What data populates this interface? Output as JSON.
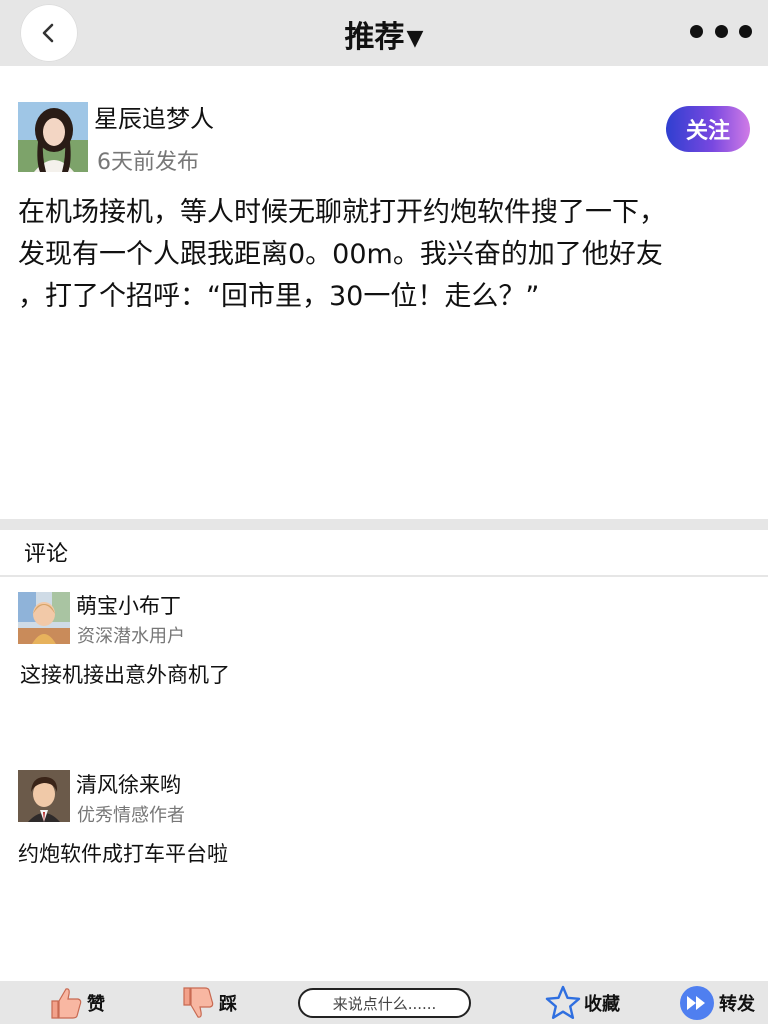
{
  "header": {
    "title": "推荐",
    "title_caret": "▼"
  },
  "post": {
    "author_name": "星辰追梦人",
    "time": "6天前发布",
    "follow_label": "关注",
    "lines": [
      "在机场接机，等人时候无聊就打开约炮软件搜了一下，",
      "发现有一个人跟我距离0。00m。我兴奋的加了他好友",
      "，打了个招呼：“回市里，30一位！走么？”"
    ]
  },
  "comments": {
    "title": "评论",
    "items": [
      {
        "name": "萌宝小布丁",
        "role": "资深潜水用户",
        "text": "这接机接出意外商机了"
      },
      {
        "name": "清风徐来哟",
        "role": "优秀情感作者",
        "text": "约炮软件成打车平台啦"
      }
    ]
  },
  "bottom_bar": {
    "like_label": "赞",
    "dislike_label": "踩",
    "input_placeholder": "来说点什么......",
    "favorite_label": "收藏",
    "share_label": "转发"
  },
  "colors": {
    "bar_bg": "#e6e6e6",
    "follow_gradient_start": "#2f3fd0",
    "follow_gradient_end": "#d07be6",
    "like_icon": "#f2a18a",
    "favorite_icon": "#2f6fe0",
    "share_icon": "#4f7ff0"
  }
}
